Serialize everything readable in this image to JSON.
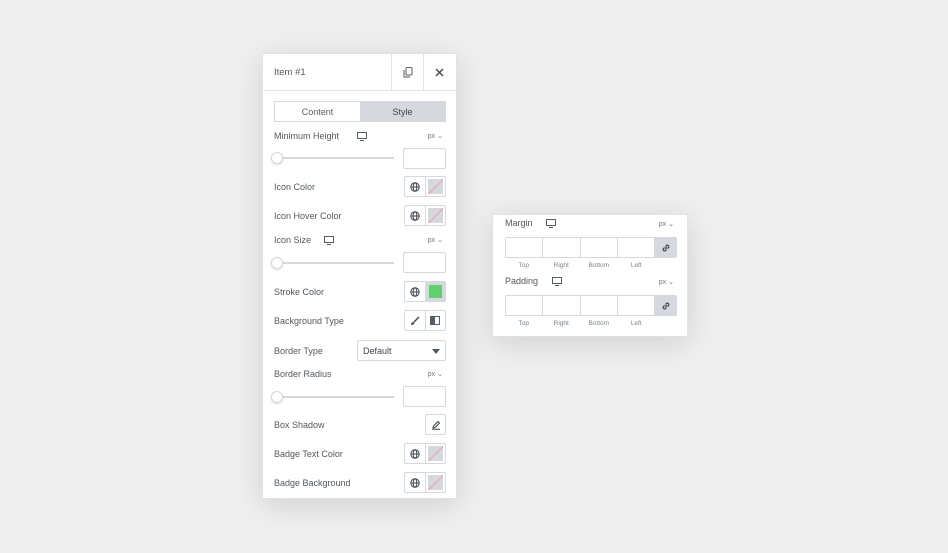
{
  "panel": {
    "title": "Item #1",
    "tabs": [
      {
        "label": "Content",
        "active": false
      },
      {
        "label": "Style",
        "active": true
      }
    ],
    "unit": "px",
    "controls": {
      "minimum_height": {
        "label": "Minimum Height",
        "unit": "px",
        "value": ""
      },
      "icon_color": {
        "label": "Icon Color"
      },
      "icon_hover_color": {
        "label": "Icon Hover Color"
      },
      "icon_size": {
        "label": "Icon Size",
        "unit": "px",
        "value": ""
      },
      "stroke_color": {
        "label": "Stroke Color",
        "color": "#61ce70"
      },
      "background_type": {
        "label": "Background Type"
      },
      "border_type": {
        "label": "Border Type",
        "value": "Default"
      },
      "border_radius": {
        "label": "Border Radius",
        "unit": "px",
        "value": ""
      },
      "box_shadow": {
        "label": "Box Shadow"
      },
      "badge_text_color": {
        "label": "Badge Text Color"
      },
      "badge_background": {
        "label": "Badge Background"
      }
    }
  },
  "side_panel": {
    "margin": {
      "label": "Margin",
      "unit": "px",
      "fields": [
        "Top",
        "Right",
        "Bottom",
        "Left"
      ]
    },
    "padding": {
      "label": "Padding",
      "unit": "px",
      "fields": [
        "Top",
        "Right",
        "Bottom",
        "Left"
      ]
    }
  },
  "icons": {
    "copy": "copy-icon",
    "close": "close-icon",
    "desktop": "desktop-icon",
    "globe": "globe-icon",
    "brush": "brush-icon",
    "gradient": "gradient-icon",
    "pencil": "pencil-icon",
    "link": "link-icon"
  },
  "colors": {
    "accent_gray": "#d5d8dc",
    "stroke_swatch": "#61ce70",
    "none_slash": "#e8a0a8"
  }
}
